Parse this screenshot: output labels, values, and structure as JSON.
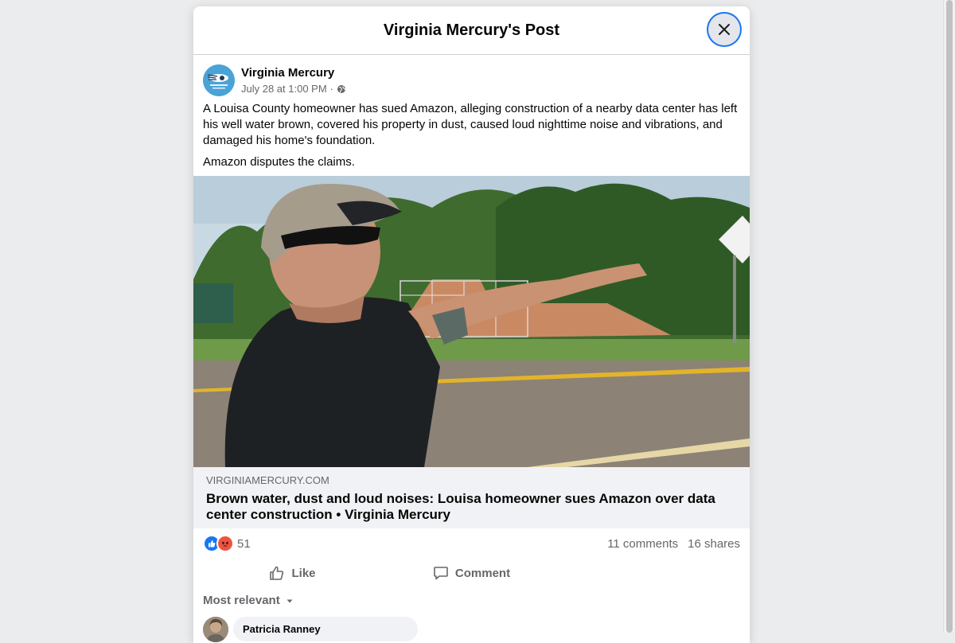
{
  "dialog": {
    "title": "Virginia Mercury's Post",
    "close_icon": "close-icon"
  },
  "post": {
    "author": "Virginia Mercury",
    "timestamp": "July 28 at 1:00 PM",
    "separator": "·",
    "audience_icon": "globe-icon",
    "paragraphs": [
      "A Louisa County homeowner has sued Amazon, alleging construction of a nearby data center has left his well water brown, covered his property in dust, caused loud nighttime noise and vibrations, and damaged his home's foundation.",
      "Amazon disputes the claims."
    ]
  },
  "link": {
    "domain": "VIRGINIAMERCURY.COM",
    "title": "Brown water, dust and loud noises: Louisa homeowner sues Amazon over data center construction • Virginia Mercury"
  },
  "stats": {
    "reaction_count": "51",
    "comments": "11 comments",
    "shares": "16 shares"
  },
  "actions": {
    "like": "Like",
    "comment": "Comment"
  },
  "comments": {
    "sort_label": "Most relevant",
    "items": [
      {
        "author": "Patricia Ranney"
      }
    ]
  },
  "colors": {
    "accent": "#1877f2",
    "angry": "#f0533f",
    "background": "#ebeced"
  }
}
